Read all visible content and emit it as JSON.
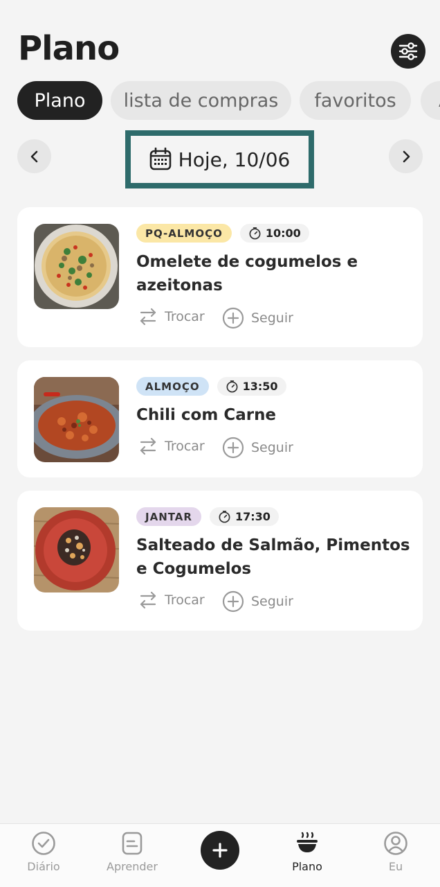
{
  "header": {
    "title": "Plano",
    "settings_icon": "sliders-icon"
  },
  "tabs": [
    {
      "label": "Plano",
      "active": true
    },
    {
      "label": "lista de compras",
      "active": false
    },
    {
      "label": "favoritos",
      "active": false
    },
    {
      "label": "A",
      "active": false
    }
  ],
  "date_nav": {
    "label": "Hoje, 10/06",
    "prev_icon": "chevron-left-icon",
    "next_icon": "chevron-right-icon"
  },
  "meals": [
    {
      "tag": "PQ-ALMOÇO",
      "tag_color": "#fbe7a6",
      "time": "10:00",
      "title": "Omelete de cogumelos e azeitonas",
      "swap_label": "Trocar",
      "follow_label": "Seguir"
    },
    {
      "tag": "ALMOÇO",
      "tag_color": "#cfe3f6",
      "time": "13:50",
      "title": "Chili com Carne",
      "swap_label": "Trocar",
      "follow_label": "Seguir"
    },
    {
      "tag": "JANTAR",
      "tag_color": "#e4d7ec",
      "time": "17:30",
      "title": "Salteado de Salmão, Pimentos e Cogumelos",
      "swap_label": "Trocar",
      "follow_label": "Seguir"
    }
  ],
  "bottom_nav": {
    "items": [
      {
        "label": "Diário",
        "icon": "check-circle-icon"
      },
      {
        "label": "Aprender",
        "icon": "document-icon"
      },
      {
        "label": "Plano",
        "icon": "bowl-icon",
        "active": true
      },
      {
        "label": "Eu",
        "icon": "user-circle-icon"
      }
    ],
    "add_icon": "plus-icon"
  }
}
